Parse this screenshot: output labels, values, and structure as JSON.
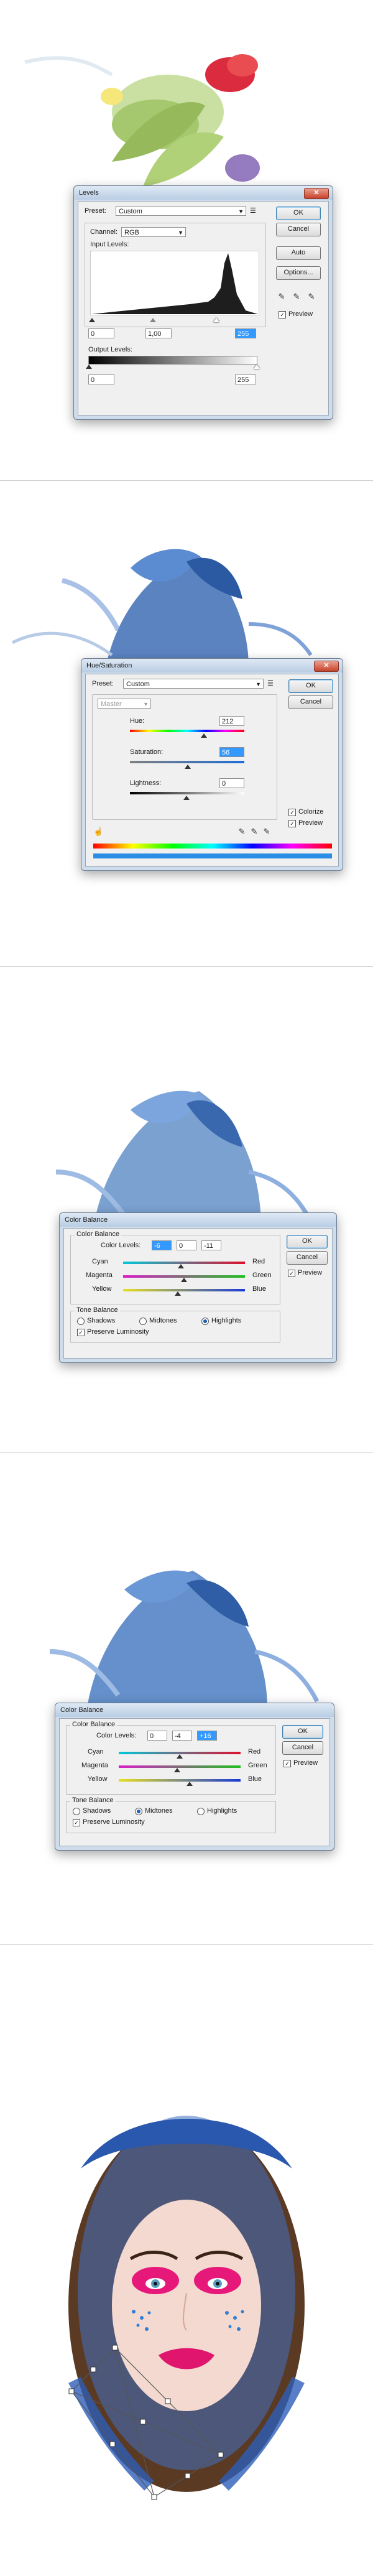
{
  "levels": {
    "title": "Levels",
    "preset_label": "Preset:",
    "preset_value": "Custom",
    "channel_label": "Channel:",
    "channel_value": "RGB",
    "input_label": "Input Levels:",
    "input_values": [
      "0",
      "1,00",
      "255"
    ],
    "output_label": "Output Levels:",
    "output_values": [
      "0",
      "255"
    ],
    "buttons": {
      "ok": "OK",
      "cancel": "Cancel",
      "auto": "Auto",
      "options": "Options..."
    },
    "preview": "Preview"
  },
  "hue": {
    "title": "Hue/Saturation",
    "preset_label": "Preset:",
    "preset_value": "Custom",
    "master": "Master",
    "hue_label": "Hue:",
    "hue_value": "212",
    "sat_label": "Saturation:",
    "sat_value": "56",
    "light_label": "Lightness:",
    "light_value": "0",
    "buttons": {
      "ok": "OK",
      "cancel": "Cancel"
    },
    "colorize": "Colorize",
    "preview": "Preview"
  },
  "cb1": {
    "title": "Color Balance",
    "group": "Color Balance",
    "levels_label": "Color Levels:",
    "levels": [
      "-6",
      "0",
      "-11"
    ],
    "rows": [
      {
        "left": "Cyan",
        "right": "Red"
      },
      {
        "left": "Magenta",
        "right": "Green"
      },
      {
        "left": "Yellow",
        "right": "Blue"
      }
    ],
    "tone_group": "Tone Balance",
    "shadows": "Shadows",
    "midtones": "Midtones",
    "highlights": "Highlights",
    "luminosity": "Preserve Luminosity",
    "buttons": {
      "ok": "OK",
      "cancel": "Cancel"
    },
    "preview": "Preview"
  },
  "cb2": {
    "title": "Color Balance",
    "group": "Color Balance",
    "levels_label": "Color Levels:",
    "levels": [
      "0",
      "-4",
      "+16"
    ],
    "rows": [
      {
        "left": "Cyan",
        "right": "Red"
      },
      {
        "left": "Magenta",
        "right": "Green"
      },
      {
        "left": "Yellow",
        "right": "Blue"
      }
    ],
    "tone_group": "Tone Balance",
    "shadows": "Shadows",
    "midtones": "Midtones",
    "highlights": "Highlights",
    "luminosity": "Preserve Luminosity",
    "buttons": {
      "ok": "OK",
      "cancel": "Cancel"
    },
    "preview": "Preview"
  },
  "colors": {
    "dialog_bg": "#f0f0f0",
    "frame": "#cfdceb",
    "blue_art": "#3b6fb8",
    "magenta": "#e6197a"
  },
  "icons": [
    "close-icon",
    "eyedropper-icon",
    "hand-icon",
    "chevron-down-icon"
  ]
}
